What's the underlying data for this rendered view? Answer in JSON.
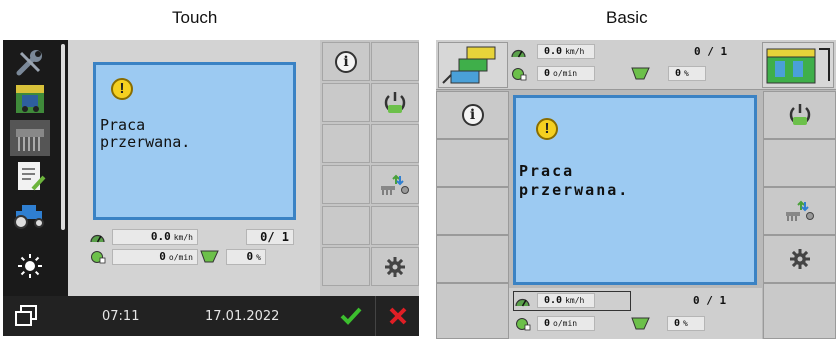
{
  "headings": {
    "touch": "Touch",
    "basic": "Basic"
  },
  "touch": {
    "sidebar_icons": [
      "wrench-icon",
      "tractor-map-icon",
      "seeder-icon",
      "notepad-icon",
      "tractor-icon",
      "brightness-icon",
      "window-switch-icon"
    ],
    "alarm": {
      "icon": "warning-icon",
      "line1": "Praca",
      "line2": "przerwana."
    },
    "speed": {
      "value": "0.0",
      "unit": "km/h"
    },
    "counter": "0/ 1",
    "rpm": {
      "value": "0",
      "unit": "o/min"
    },
    "percent": {
      "value": "0",
      "unit": "%"
    },
    "softkeys": [
      "info-icon",
      "on-icon",
      "implement-arrows-icon",
      "settings-icon"
    ],
    "time": "07:11",
    "date": "17.01.2022",
    "confirm_icon": "check-icon",
    "cancel_icon": "close-icon"
  },
  "basic": {
    "top": {
      "speed": {
        "value": "0.0",
        "unit": "km/h"
      },
      "counter": "0 / 1",
      "rpm": {
        "value": "0",
        "unit": "o/min"
      },
      "percent": {
        "value": "0",
        "unit": "%"
      }
    },
    "alarm": {
      "icon": "warning-icon",
      "line1": "Praca",
      "line2": "przerwana."
    },
    "bottom": {
      "speed": {
        "value": "0.0",
        "unit": "km/h"
      },
      "counter": "0 / 1",
      "rpm": {
        "value": "0",
        "unit": "o/min"
      },
      "percent": {
        "value": "0",
        "unit": "%"
      }
    },
    "softkeys": [
      "info-icon",
      "on-icon",
      "implement-arrows-icon",
      "settings-icon"
    ]
  }
}
